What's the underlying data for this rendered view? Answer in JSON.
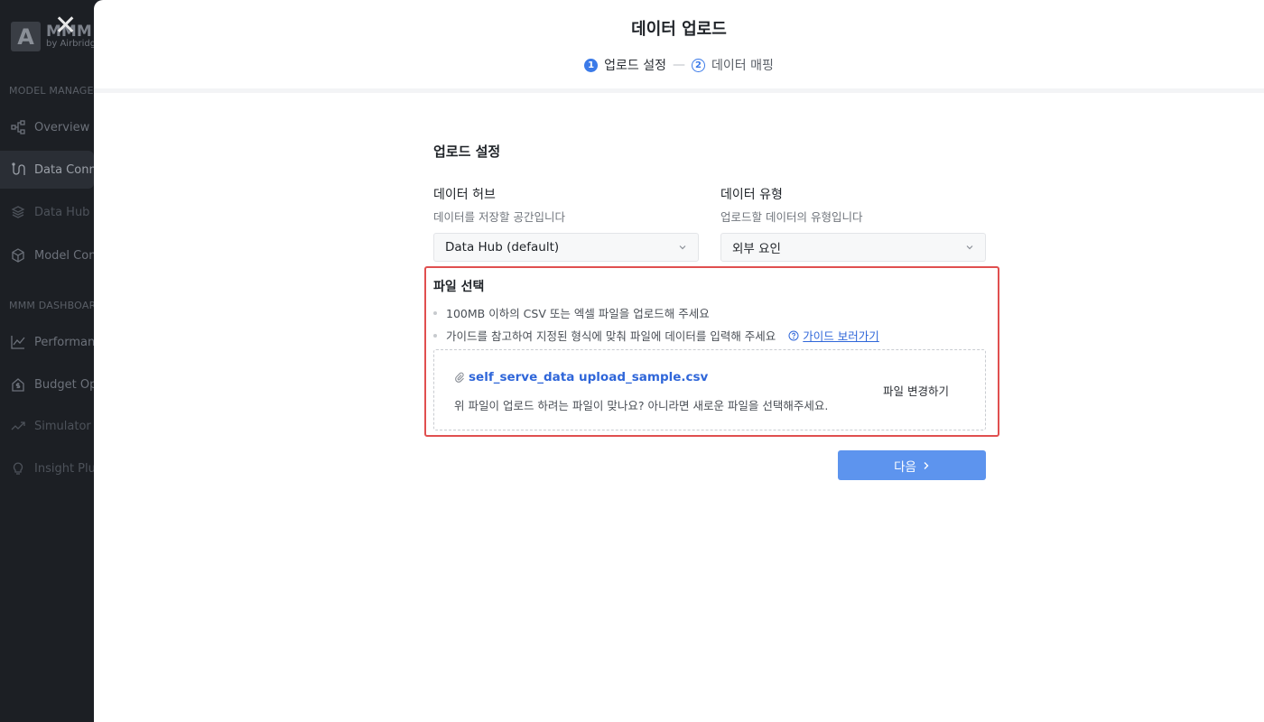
{
  "sidebar": {
    "logo_letter": "A",
    "logo_title": "MMM",
    "logo_sub": "by Airbridge",
    "section1": "MODEL MANAGER",
    "section2": "MMM DASHBOARD",
    "items": [
      {
        "label": "Overview",
        "icon": "hierarchy-icon"
      },
      {
        "label": "Data Conn",
        "icon": "connector-icon"
      },
      {
        "label": "Data Hub",
        "icon": "layers-icon"
      },
      {
        "label": "Model Con",
        "icon": "cube-icon"
      },
      {
        "label": "Performan",
        "icon": "line-chart-icon"
      },
      {
        "label": "Budget Op",
        "icon": "house-dollar-icon"
      },
      {
        "label": "Simulator",
        "icon": "trend-icon"
      },
      {
        "label": "Insight Plu",
        "icon": "lightbulb-icon"
      }
    ]
  },
  "modal": {
    "title": "데이터 업로드",
    "steps": [
      {
        "num": "1",
        "label": "업로드 설정"
      },
      {
        "num": "2",
        "label": "데이터 매핑"
      }
    ],
    "step_separator": "—"
  },
  "upload": {
    "section_title": "업로드 설정",
    "hub": {
      "label": "데이터 허브",
      "help": "데이터를 저장할 공간입니다",
      "value": "Data Hub (default)"
    },
    "type": {
      "label": "데이터 유형",
      "help": "업로드할 데이터의 유형입니다",
      "value": "외부 요인"
    }
  },
  "file": {
    "title": "파일 선택",
    "bullet1": "100MB 이하의 CSV 또는 엑셀 파일을 업로드해 주세요",
    "bullet2": "가이드를 참고하여 지정된 형식에 맞춰 파일에 데이터를 입력해 주세요",
    "guide_link": "가이드 보러가기",
    "file_name": "self_serve_data upload_sample.csv",
    "message": "위 파일이 업로드 하려는 파일이 맞나요? 아니라면 새로운 파일을 선택해주세요.",
    "change_label": "파일 변경하기"
  },
  "next_label": "다음",
  "colors": {
    "accent": "#3b7ae8",
    "button": "#5d94ee",
    "highlight": "#e04f4f",
    "link": "#2f66d9"
  }
}
